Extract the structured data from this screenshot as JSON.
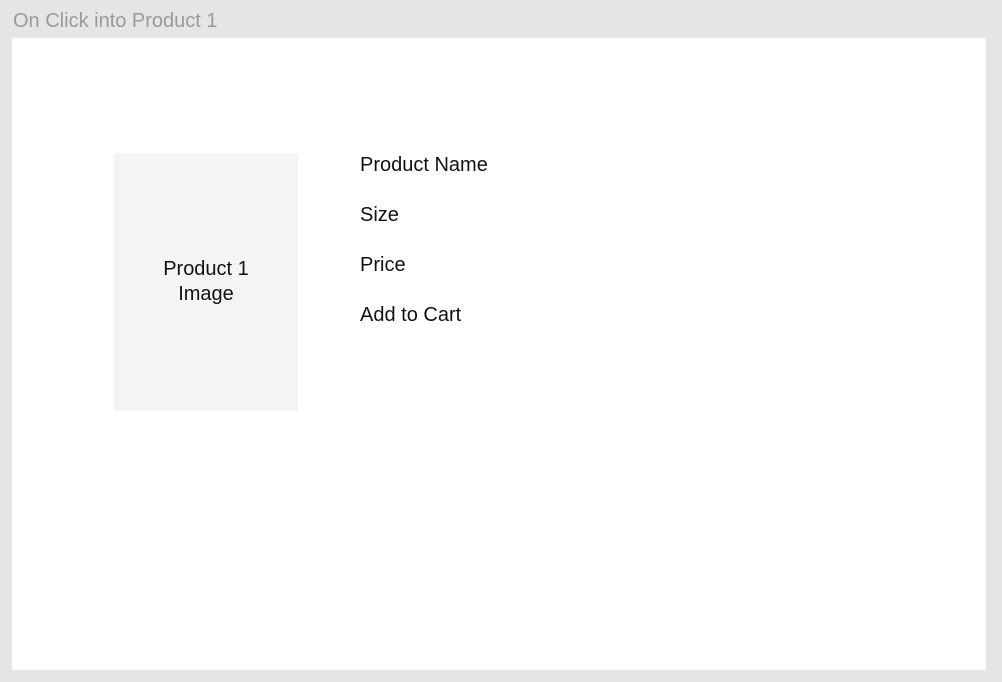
{
  "frame": {
    "title": "On Click into Product 1"
  },
  "product": {
    "image_label": "Product 1\nImage",
    "name_label": "Product Name",
    "size_label": "Size",
    "price_label": "Price",
    "add_to_cart_label": "Add to Cart"
  },
  "colors": {
    "canvas_background": "#e5e5e5",
    "frame_background": "#ffffff",
    "image_placeholder": "#f4f4f4",
    "label_gray": "#9a9a9a",
    "text": "#111111"
  }
}
